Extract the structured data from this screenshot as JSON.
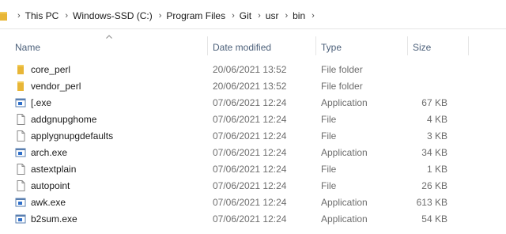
{
  "breadcrumb": [
    "This PC",
    "Windows-SSD (C:)",
    "Program Files",
    "Git",
    "usr",
    "bin"
  ],
  "columns": {
    "name": "Name",
    "date": "Date modified",
    "type": "Type",
    "size": "Size"
  },
  "files": [
    {
      "icon": "folder-icon",
      "name": "core_perl",
      "date": "20/06/2021 13:52",
      "type": "File folder",
      "size": ""
    },
    {
      "icon": "folder-icon",
      "name": "vendor_perl",
      "date": "20/06/2021 13:52",
      "type": "File folder",
      "size": ""
    },
    {
      "icon": "application-icon",
      "name": "[.exe",
      "date": "07/06/2021 12:24",
      "type": "Application",
      "size": "67 KB"
    },
    {
      "icon": "file-icon",
      "name": "addgnupghome",
      "date": "07/06/2021 12:24",
      "type": "File",
      "size": "4 KB"
    },
    {
      "icon": "file-icon",
      "name": "applygnupgdefaults",
      "date": "07/06/2021 12:24",
      "type": "File",
      "size": "3 KB"
    },
    {
      "icon": "application-icon",
      "name": "arch.exe",
      "date": "07/06/2021 12:24",
      "type": "Application",
      "size": "34 KB"
    },
    {
      "icon": "file-icon",
      "name": "astextplain",
      "date": "07/06/2021 12:24",
      "type": "File",
      "size": "1 KB"
    },
    {
      "icon": "file-icon",
      "name": "autopoint",
      "date": "07/06/2021 12:24",
      "type": "File",
      "size": "26 KB"
    },
    {
      "icon": "application-icon",
      "name": "awk.exe",
      "date": "07/06/2021 12:24",
      "type": "Application",
      "size": "613 KB"
    },
    {
      "icon": "application-icon",
      "name": "b2sum.exe",
      "date": "07/06/2021 12:24",
      "type": "Application",
      "size": "54 KB"
    }
  ],
  "colors": {
    "folder": "#e8b637",
    "app_blue": "#2f6fc9",
    "header_text": "#4c607a"
  }
}
